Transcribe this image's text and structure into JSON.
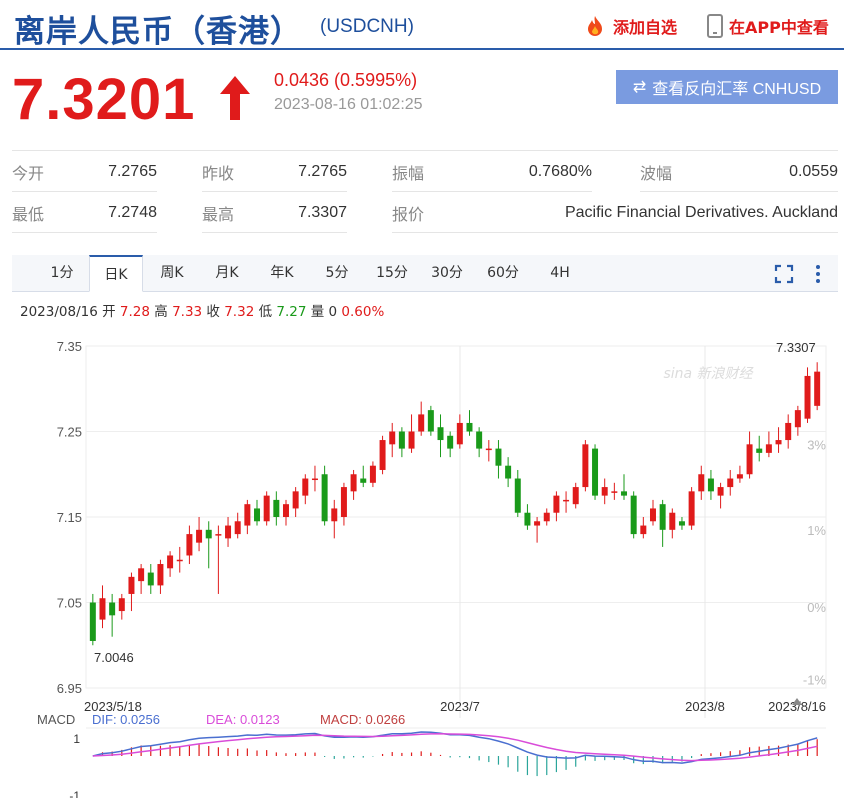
{
  "header": {
    "title": "离岸人民币（香港）",
    "symbol": "(USDCNH)",
    "add_watch": "添加自选",
    "view_in_app": "在APP中查看"
  },
  "quote": {
    "price": "7.3201",
    "change": "0.0436 (0.5995%)",
    "time": "2023-08-16 01:02:25",
    "reverse_button": "查看反向汇率 CNHUSD"
  },
  "stats": {
    "open_label": "今开",
    "open": "7.2765",
    "prev_close_label": "昨收",
    "prev_close": "7.2765",
    "amplitude_label": "振幅",
    "amplitude": "0.7680%",
    "wave_label": "波幅",
    "wave": "0.0559",
    "low_label": "最低",
    "low": "7.2748",
    "high_label": "最高",
    "high": "7.3307",
    "quote_label": "报价",
    "quote_source": "Pacific Financial Derivatives. Auckland"
  },
  "tabs": [
    "1分",
    "日K",
    "周K",
    "月K",
    "年K",
    "5分",
    "15分",
    "30分",
    "60分",
    "4H"
  ],
  "active_tab": "日K",
  "ohlc": {
    "date": "2023/08/16",
    "open_label": "开",
    "open": "7.28",
    "high_label": "高",
    "high": "7.33",
    "close_label": "收",
    "close": "7.32",
    "low_label": "低",
    "low": "7.27",
    "vol_label": "量",
    "vol": "0",
    "pct": "0.60%"
  },
  "colors": {
    "up": "#e01b1b",
    "down": "#1a9a1a",
    "accent": "#2a5caa",
    "dif": "#4a6fd0",
    "dea": "#d94cd9"
  },
  "watermark": "sina 新浪财经",
  "chart_data": {
    "type": "candlestick",
    "y_ticks": [
      "7.35",
      "7.25",
      "7.15",
      "7.05",
      "6.95"
    ],
    "y_range": [
      6.95,
      7.35
    ],
    "right_ticks": [
      "3%",
      "1%",
      "0%",
      "-1%"
    ],
    "x_labels": [
      "2023/5/18",
      "2023/7",
      "2023/8",
      "2023/8/16"
    ],
    "max_label": "7.3307",
    "min_label": "7.0046",
    "candles": [
      [
        7.05,
        7.005,
        7.06,
        7.0
      ],
      [
        7.03,
        7.055,
        7.07,
        7.02
      ],
      [
        7.05,
        7.035,
        7.06,
        7.01
      ],
      [
        7.04,
        7.055,
        7.06,
        7.03
      ],
      [
        7.06,
        7.08,
        7.085,
        7.04
      ],
      [
        7.075,
        7.09,
        7.095,
        7.06
      ],
      [
        7.085,
        7.07,
        7.095,
        7.06
      ],
      [
        7.07,
        7.095,
        7.1,
        7.06
      ],
      [
        7.09,
        7.105,
        7.11,
        7.08
      ],
      [
        7.1,
        7.1,
        7.115,
        7.085
      ],
      [
        7.105,
        7.13,
        7.14,
        7.095
      ],
      [
        7.12,
        7.135,
        7.15,
        7.11
      ],
      [
        7.135,
        7.125,
        7.145,
        7.09
      ],
      [
        7.13,
        7.13,
        7.14,
        7.06
      ],
      [
        7.125,
        7.14,
        7.15,
        7.115
      ],
      [
        7.13,
        7.145,
        7.155,
        7.125
      ],
      [
        7.14,
        7.165,
        7.17,
        7.13
      ],
      [
        7.16,
        7.145,
        7.17,
        7.14
      ],
      [
        7.145,
        7.175,
        7.18,
        7.14
      ],
      [
        7.17,
        7.15,
        7.18,
        7.14
      ],
      [
        7.15,
        7.165,
        7.17,
        7.14
      ],
      [
        7.16,
        7.18,
        7.185,
        7.15
      ],
      [
        7.175,
        7.195,
        7.2,
        7.165
      ],
      [
        7.195,
        7.195,
        7.21,
        7.18
      ],
      [
        7.2,
        7.145,
        7.21,
        7.14
      ],
      [
        7.145,
        7.16,
        7.17,
        7.125
      ],
      [
        7.15,
        7.185,
        7.19,
        7.14
      ],
      [
        7.18,
        7.2,
        7.205,
        7.17
      ],
      [
        7.195,
        7.19,
        7.21,
        7.185
      ],
      [
        7.19,
        7.21,
        7.215,
        7.185
      ],
      [
        7.205,
        7.24,
        7.245,
        7.2
      ],
      [
        7.235,
        7.25,
        7.26,
        7.22
      ],
      [
        7.25,
        7.23,
        7.255,
        7.22
      ],
      [
        7.23,
        7.25,
        7.27,
        7.225
      ],
      [
        7.25,
        7.27,
        7.285,
        7.245
      ],
      [
        7.275,
        7.25,
        7.28,
        7.245
      ],
      [
        7.255,
        7.24,
        7.27,
        7.22
      ],
      [
        7.245,
        7.23,
        7.25,
        7.22
      ],
      [
        7.235,
        7.26,
        7.27,
        7.23
      ],
      [
        7.26,
        7.25,
        7.275,
        7.245
      ],
      [
        7.25,
        7.23,
        7.255,
        7.22
      ],
      [
        7.23,
        7.23,
        7.24,
        7.215
      ],
      [
        7.23,
        7.21,
        7.24,
        7.195
      ],
      [
        7.21,
        7.195,
        7.22,
        7.185
      ],
      [
        7.195,
        7.155,
        7.205,
        7.15
      ],
      [
        7.155,
        7.14,
        7.165,
        7.135
      ],
      [
        7.14,
        7.145,
        7.15,
        7.12
      ],
      [
        7.145,
        7.155,
        7.16,
        7.14
      ],
      [
        7.155,
        7.175,
        7.18,
        7.145
      ],
      [
        7.17,
        7.17,
        7.18,
        7.155
      ],
      [
        7.165,
        7.185,
        7.19,
        7.16
      ],
      [
        7.185,
        7.235,
        7.24,
        7.18
      ],
      [
        7.23,
        7.175,
        7.235,
        7.17
      ],
      [
        7.175,
        7.185,
        7.195,
        7.165
      ],
      [
        7.18,
        7.18,
        7.19,
        7.17
      ],
      [
        7.18,
        7.175,
        7.2,
        7.17
      ],
      [
        7.175,
        7.13,
        7.18,
        7.125
      ],
      [
        7.13,
        7.14,
        7.15,
        7.125
      ],
      [
        7.145,
        7.16,
        7.17,
        7.14
      ],
      [
        7.165,
        7.135,
        7.17,
        7.115
      ],
      [
        7.135,
        7.155,
        7.16,
        7.125
      ],
      [
        7.145,
        7.14,
        7.15,
        7.135
      ],
      [
        7.14,
        7.18,
        7.185,
        7.135
      ],
      [
        7.18,
        7.2,
        7.21,
        7.17
      ],
      [
        7.195,
        7.18,
        7.205,
        7.17
      ],
      [
        7.175,
        7.185,
        7.19,
        7.16
      ],
      [
        7.185,
        7.195,
        7.205,
        7.175
      ],
      [
        7.195,
        7.2,
        7.21,
        7.19
      ],
      [
        7.2,
        7.235,
        7.25,
        7.195
      ],
      [
        7.23,
        7.225,
        7.245,
        7.215
      ],
      [
        7.225,
        7.235,
        7.25,
        7.22
      ],
      [
        7.235,
        7.24,
        7.255,
        7.225
      ],
      [
        7.24,
        7.26,
        7.27,
        7.23
      ],
      [
        7.255,
        7.275,
        7.28,
        7.245
      ],
      [
        7.265,
        7.315,
        7.325,
        7.26
      ],
      [
        7.28,
        7.32,
        7.331,
        7.275
      ]
    ],
    "macd": {
      "label": "MACD",
      "dif_label": "DIF: 0.0256",
      "dea_label": "DEA: 0.0123",
      "macd_label": "MACD: 0.0266",
      "y_ticks": [
        "1",
        "-1"
      ]
    }
  }
}
